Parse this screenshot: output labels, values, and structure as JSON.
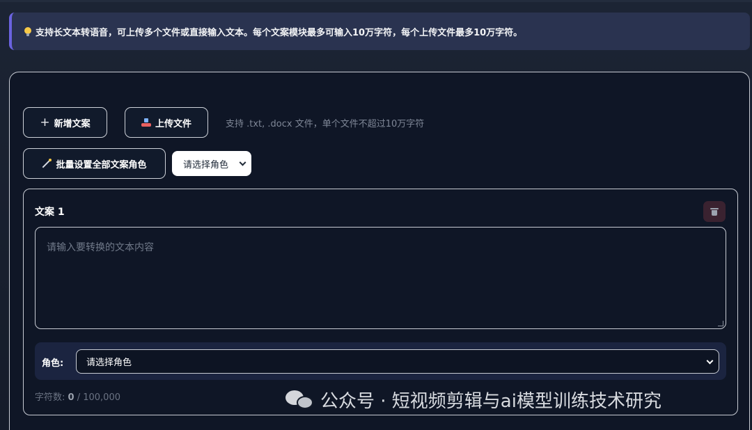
{
  "banner": {
    "icon": "lightbulb-icon",
    "text": "支持长文本转语音，可上传多个文件或直接输入文本。每个文案模块最多可输入10万字符，每个上传文件最多10万字符。"
  },
  "toolbar": {
    "add_label": "新增文案",
    "upload_label": "上传文件",
    "upload_hint": "支持 .txt, .docx 文件，单个文件不超过10万字符",
    "batch_label": "批量设置全部文案角色",
    "batch_select_value": "请选择角色"
  },
  "copy_blocks": [
    {
      "title": "文案 1",
      "textarea_placeholder": "请输入要转换的文本内容",
      "role_label": "角色:",
      "role_select_value": "请选择角色",
      "charcount_label": "字符数:",
      "charcount_value": "0",
      "charcount_max": "/ 100,000"
    }
  ],
  "watermark": {
    "icon": "wechat-icon",
    "text": "公众号 · 短视频剪辑与ai模型训练技术研究"
  },
  "colors": {
    "accent": "#6b63e0",
    "background": "#0f1626",
    "banner_bg": "#2a3350"
  }
}
